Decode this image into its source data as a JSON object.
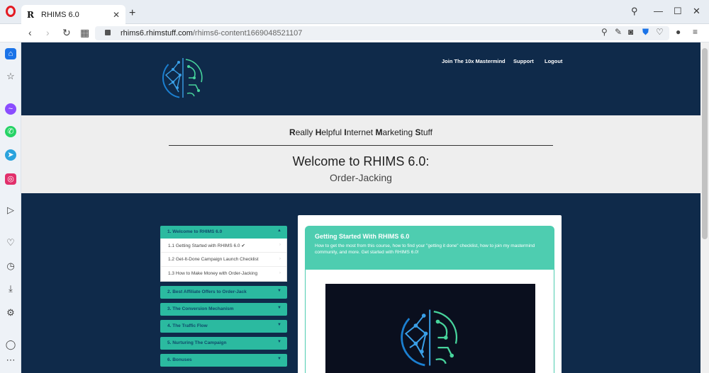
{
  "browser": {
    "tab_title": "RHIMS 6.0",
    "tab_favicon": "R",
    "url_host": "rhims6.rhimstuff.com",
    "url_path": "/rhims6-content1669048521107"
  },
  "site": {
    "nav": [
      "Join The 10x Mastermind",
      "Support",
      "Logout"
    ],
    "tagline_parts": [
      {
        "b": "R",
        "t": "eally "
      },
      {
        "b": "H",
        "t": "elpful "
      },
      {
        "b": "I",
        "t": "nternet "
      },
      {
        "b": "M",
        "t": "arketing "
      },
      {
        "b": "S",
        "t": "tuff"
      }
    ],
    "welcome": "Welcome to RHIMS 6.0:",
    "subtitle": "Order-Jacking"
  },
  "course_menu": {
    "sections": [
      {
        "label": "1. Welcome to RHIMS 6.0",
        "open": true,
        "caret": "▲",
        "items": [
          {
            "label": "1.1 Getting Started with RHIMS 6.0 ✔",
            "active": true
          },
          {
            "label": "1.2 Get-It-Done Campaign Launch Checklist",
            "active": false
          },
          {
            "label": "1.3 How to Make Money with Order-Jacking",
            "active": false
          }
        ]
      },
      {
        "label": "2. Best Affiliate Offers to Order-Jack",
        "open": false,
        "caret": "▼"
      },
      {
        "label": "3. The Conversion Mechanism",
        "open": false,
        "caret": "▼"
      },
      {
        "label": "4. The Traffic Flow",
        "open": false,
        "caret": "▼"
      },
      {
        "label": "5. Nurturing The Campaign",
        "open": false,
        "caret": "▼"
      },
      {
        "label": "6. Bonuses",
        "open": false,
        "caret": "▼"
      }
    ]
  },
  "lesson": {
    "title": "Getting Started With RHIMS 6.0",
    "description": "How to get the most from this course, how to find your \"getting it done\" checklist, how to join my mastermind community, and more. Get started with RHIMS 6.0!"
  },
  "colors": {
    "navy": "#0f2a4a",
    "teal": "#2bbaa0",
    "teal_light": "#4ecdb0",
    "band": "#eeeeee"
  },
  "icons": {
    "sidebar": [
      "home-icon",
      "star-icon",
      "messenger-icon",
      "whatsapp-icon",
      "telegram-icon",
      "instagram-icon",
      "player-icon",
      "heart-icon",
      "history-icon",
      "download-icon",
      "settings-icon",
      "lightbulb-icon",
      "more-icon"
    ]
  }
}
